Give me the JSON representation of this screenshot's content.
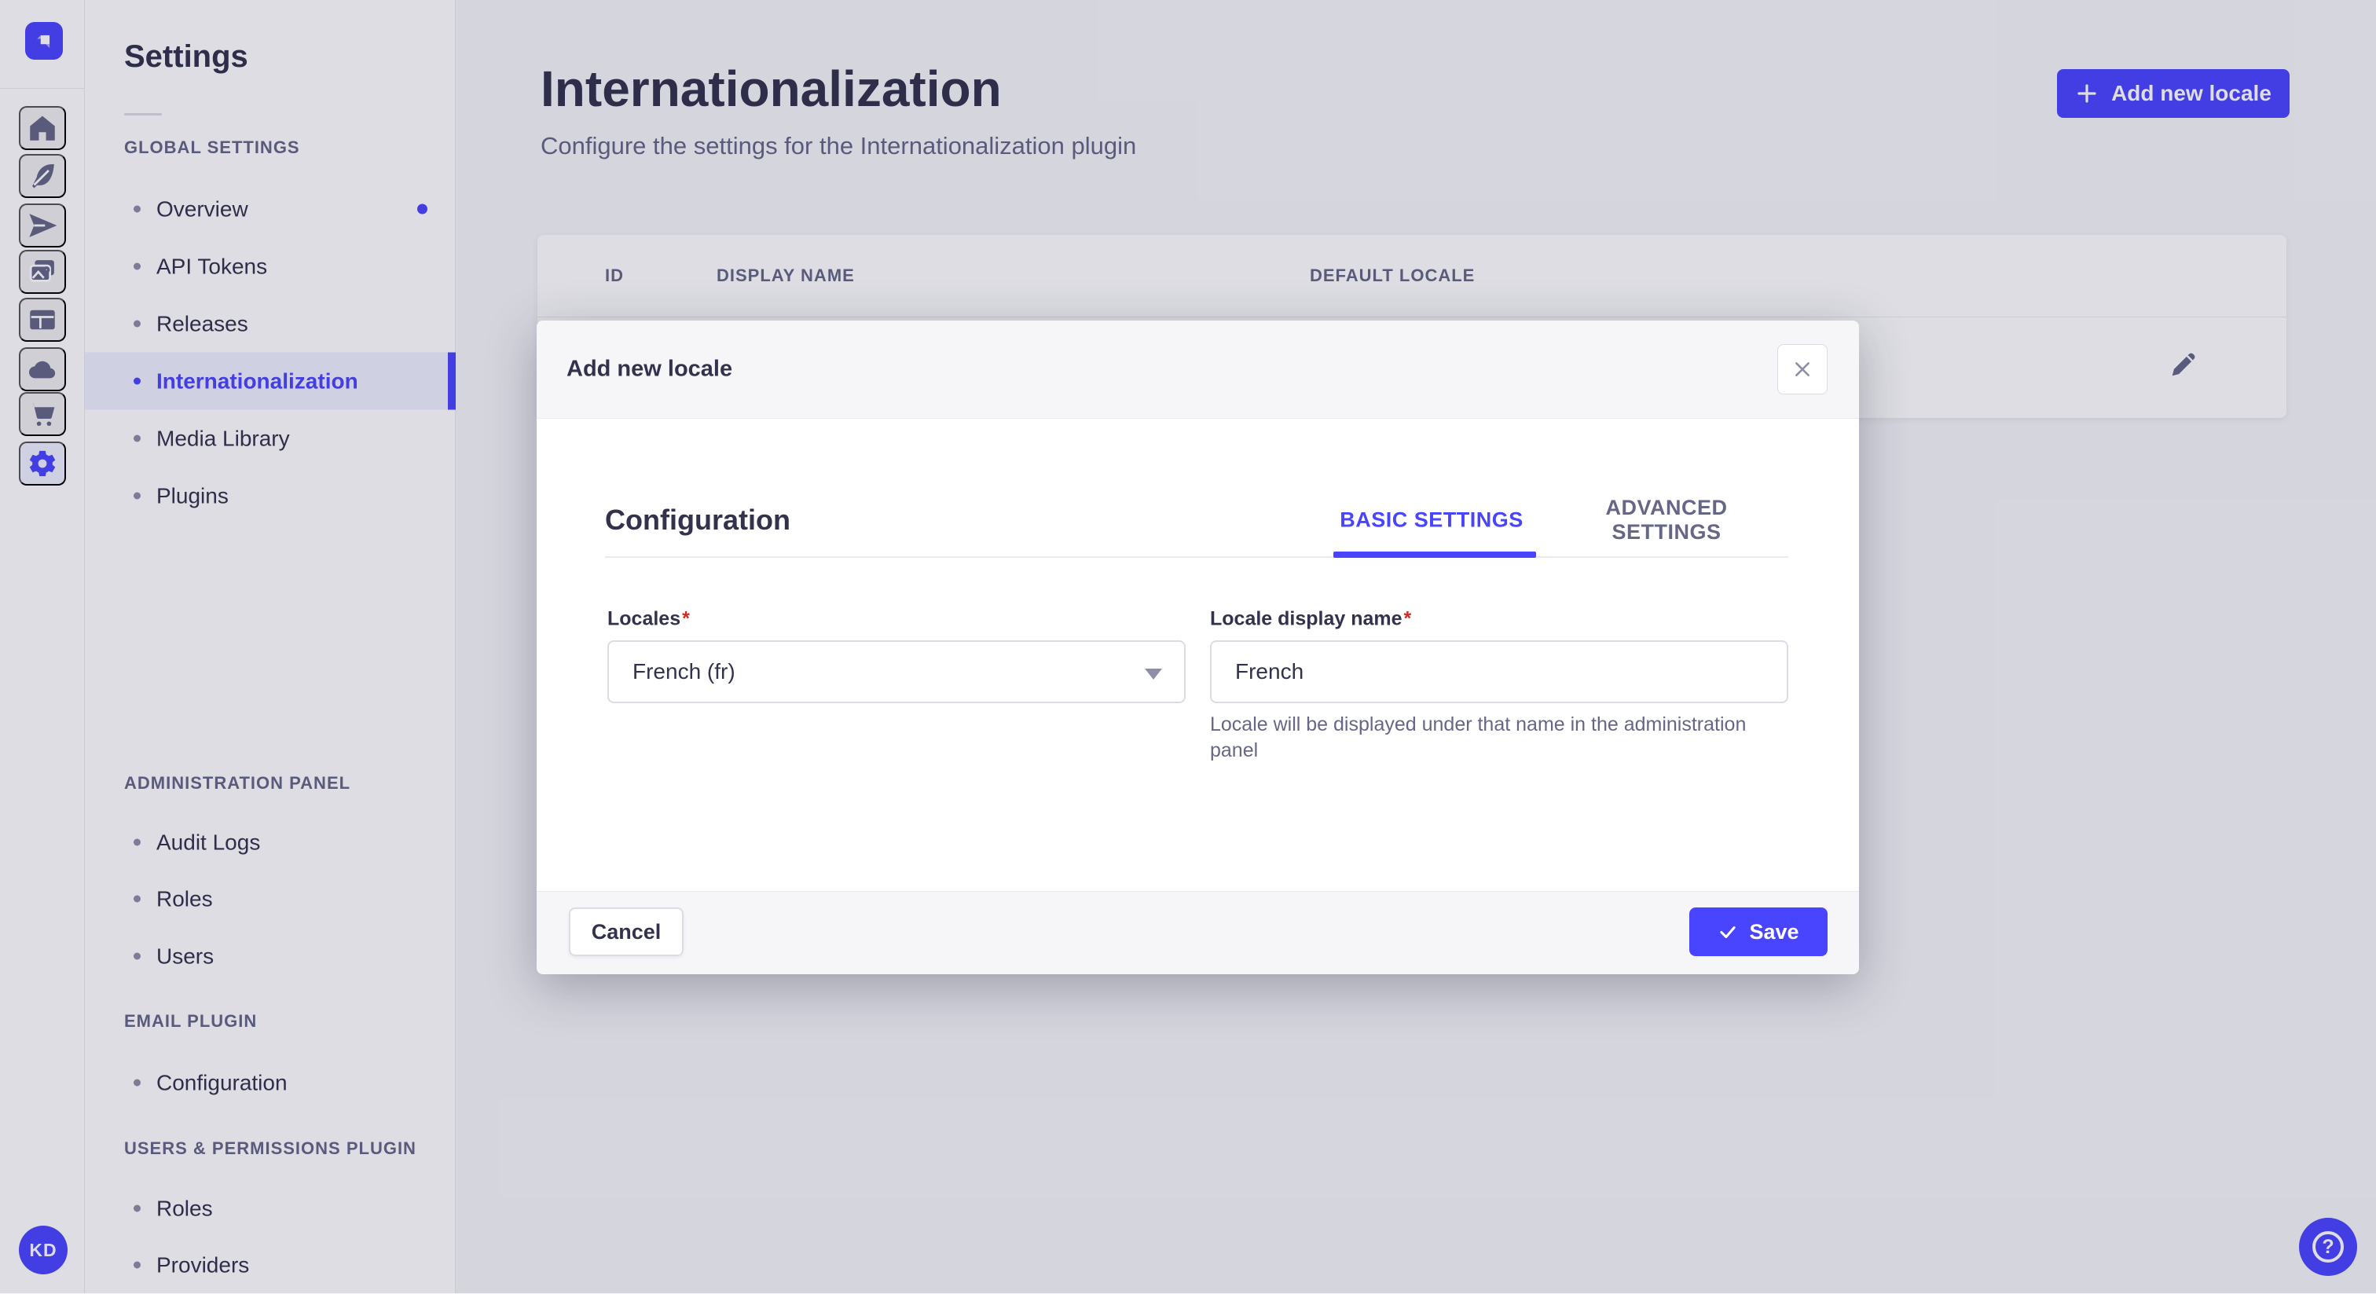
{
  "colors": {
    "primary": "#4945ff",
    "primary_light": "#f0f0ff",
    "text": "#32324d",
    "text_muted": "#666687",
    "border": "#dcdce4",
    "divider": "#eaeaef",
    "background": "#f6f6f9",
    "surface": "#ffffff",
    "required_red": "#d02b20"
  },
  "rail": {
    "logo_icon": "strapi-logo",
    "icons": [
      "home",
      "feather",
      "paper-plane",
      "media-library",
      "content-layout",
      "cloud",
      "marketplace-cart",
      "settings-gear"
    ],
    "active_icon": "settings-gear",
    "avatar_initials": "KD"
  },
  "sidebar": {
    "title": "Settings",
    "sections": [
      {
        "header": "GLOBAL SETTINGS",
        "items": [
          {
            "label": "Overview",
            "notification": true
          },
          {
            "label": "API Tokens"
          },
          {
            "label": "Releases"
          },
          {
            "label": "Internationalization",
            "active": true
          },
          {
            "label": "Media Library"
          },
          {
            "label": "Plugins"
          }
        ]
      },
      {
        "header": "ADMINISTRATION PANEL",
        "items": [
          {
            "label": "Audit Logs"
          },
          {
            "label": "Roles"
          },
          {
            "label": "Users"
          }
        ]
      },
      {
        "header": "EMAIL PLUGIN",
        "items": [
          {
            "label": "Configuration"
          }
        ]
      },
      {
        "header": "USERS & PERMISSIONS PLUGIN",
        "items": [
          {
            "label": "Roles"
          },
          {
            "label": "Providers"
          }
        ]
      }
    ]
  },
  "main": {
    "title": "Internationalization",
    "subtitle": "Configure the settings for the Internationalization plugin",
    "add_button_label": "Add new locale",
    "table": {
      "columns": [
        "ID",
        "DISPLAY NAME",
        "DEFAULT LOCALE"
      ]
    },
    "row_action_icon": "pencil-edit"
  },
  "modal": {
    "title": "Add new locale",
    "close_icon": "close-x",
    "section_title": "Configuration",
    "tabs": [
      {
        "label": "BASIC SETTINGS",
        "active": true
      },
      {
        "label": "ADVANCED SETTINGS",
        "active": false
      }
    ],
    "fields": {
      "locales": {
        "label": "Locales",
        "required_mark": "*",
        "value": "French (fr)"
      },
      "display_name": {
        "label": "Locale display name",
        "required_mark": "*",
        "value": "French",
        "helper": "Locale will be displayed under that name in the administration panel"
      }
    },
    "footer": {
      "cancel_label": "Cancel",
      "save_label": "Save"
    }
  },
  "help_button": {
    "icon": "question-mark"
  }
}
